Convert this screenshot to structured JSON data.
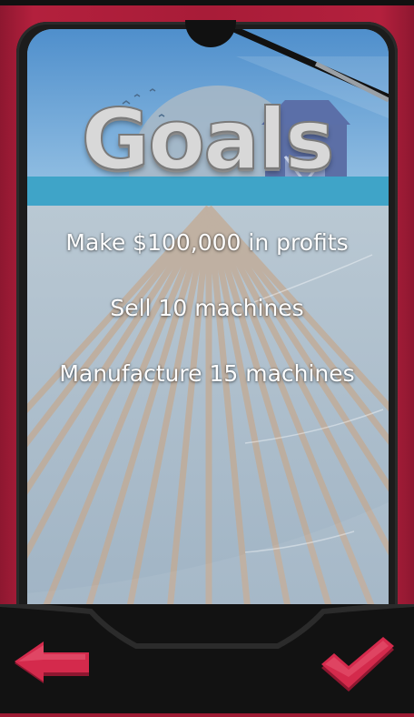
{
  "title": "Goals",
  "goals": [
    "Make $100,000 in profits",
    "Sell 10 machines",
    "Manufacture 15 machines"
  ],
  "colors": {
    "frame": "#a81c38",
    "panel": "#121212",
    "button_red": "#d42a4c"
  },
  "icons": {
    "back": "arrow-left-icon",
    "confirm": "checkmark-icon"
  }
}
